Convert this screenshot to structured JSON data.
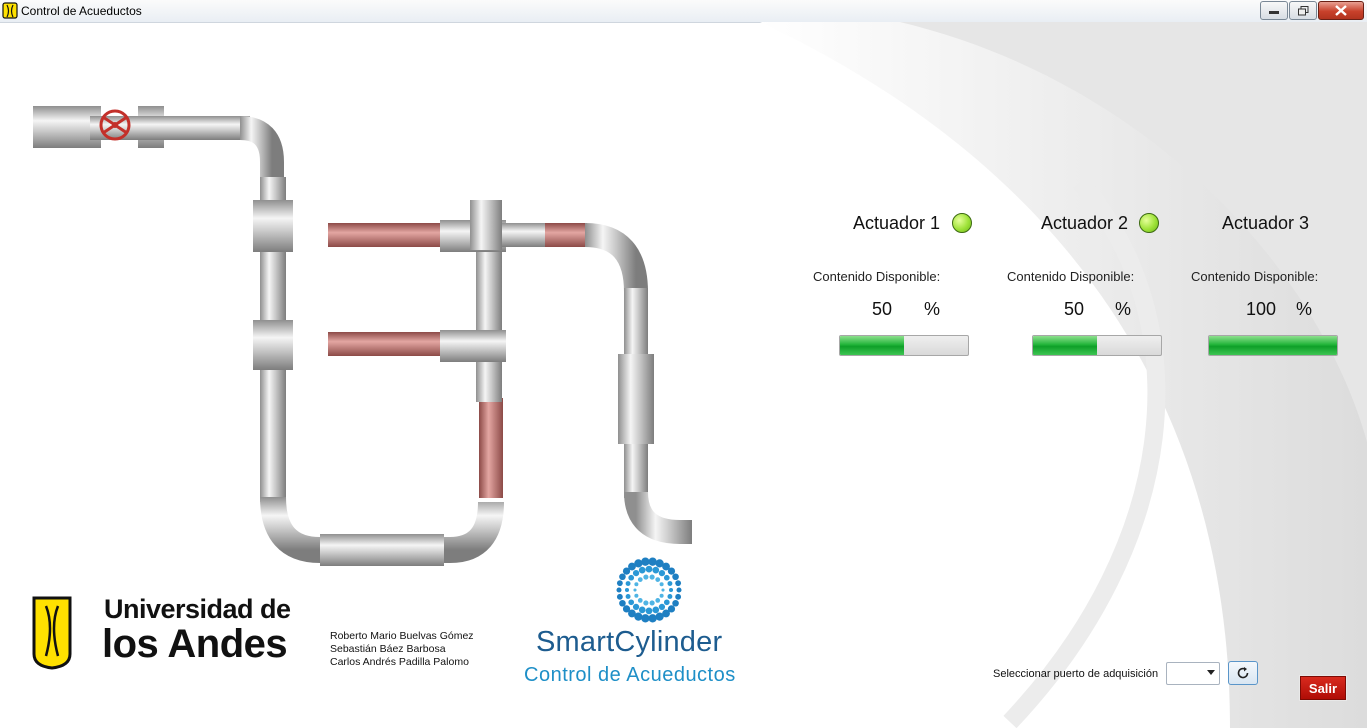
{
  "window": {
    "title": "Control de Acueductos",
    "controls": {
      "minimize": "minimize-icon",
      "restore": "restore-icon",
      "close": "close-icon"
    }
  },
  "actuators": [
    {
      "label": "Actuador 1",
      "led": "green",
      "contenido_label": "Contenido Disponible:",
      "value": "50",
      "unit": "%",
      "fill_percent": 50
    },
    {
      "label": "Actuador 2",
      "led": "green",
      "contenido_label": "Contenido Disponible:",
      "value": "50",
      "unit": "%",
      "fill_percent": 50
    },
    {
      "label": "Actuador 3",
      "led": "none",
      "contenido_label": "Contenido Disponible:",
      "value": "100",
      "unit": "%",
      "fill_percent": 100
    }
  ],
  "university": {
    "line1": "Universidad de",
    "line2": "los Andes"
  },
  "authors": [
    "Roberto Mario Buelvas Gómez",
    "Sebastián Báez Barbosa",
    "Carlos Andrés Padilla Palomo"
  ],
  "brand": {
    "name": "SmartCylinder",
    "subtitle": "Control de Acueductos"
  },
  "port": {
    "label": "Seleccionar puerto de adquisición",
    "selected": "",
    "refresh_icon": "refresh-icon"
  },
  "exit_button": "Salir",
  "colors": {
    "led_green": "#9ee238",
    "bar_green": "#22b53a",
    "pipe_red": "#c47a76",
    "exit_red": "#c01a10",
    "brand_blue": "#1d5c8f"
  }
}
